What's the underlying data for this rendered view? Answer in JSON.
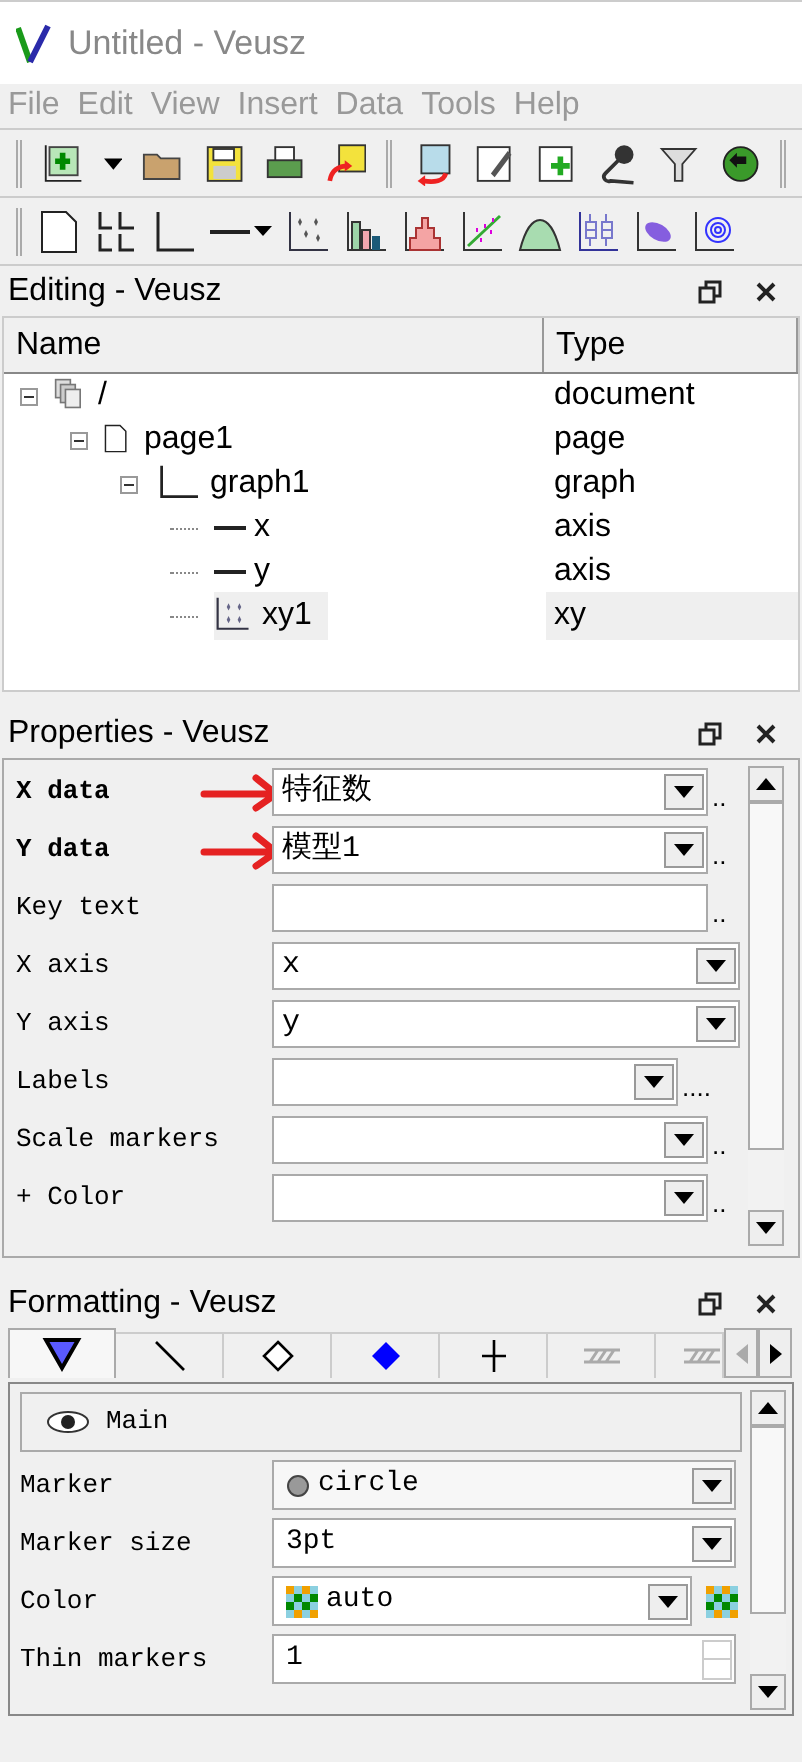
{
  "window": {
    "title": "Untitled - Veusz"
  },
  "menu": [
    "File",
    "Edit",
    "View",
    "Insert",
    "Data",
    "Tools",
    "Help"
  ],
  "editing": {
    "title": "Editing - Veusz",
    "columns": [
      "Name",
      "Type"
    ],
    "tree": [
      {
        "name": "/",
        "type": "document",
        "kind": "stack",
        "expanded": true,
        "selected": false,
        "children": [
          {
            "name": "page1",
            "type": "page",
            "kind": "sheet",
            "expanded": true,
            "selected": false,
            "children": [
              {
                "name": "graph1",
                "type": "graph",
                "kind": "frame",
                "expanded": true,
                "selected": false,
                "children": [
                  {
                    "name": "x",
                    "type": "axis",
                    "kind": "line",
                    "selected": false
                  },
                  {
                    "name": "y",
                    "type": "axis",
                    "kind": "line",
                    "selected": false
                  },
                  {
                    "name": "xy1",
                    "type": "xy",
                    "kind": "points",
                    "selected": true
                  }
                ]
              }
            ]
          }
        ]
      }
    ]
  },
  "properties": {
    "title": "Properties - Veusz",
    "rows": [
      {
        "label": "X data",
        "kind": "combo",
        "value": "特征数",
        "bold": true,
        "dots": "..",
        "annotated": true
      },
      {
        "label": "Y data",
        "kind": "combo",
        "value": "模型1",
        "bold": true,
        "dots": "..",
        "annotated": true
      },
      {
        "label": "Key text",
        "kind": "text",
        "bold": false,
        "dots": "..",
        "annotated": false
      },
      {
        "label": "X axis",
        "kind": "combo",
        "value": "x",
        "bold": false,
        "annotated": false
      },
      {
        "label": "Y axis",
        "kind": "combo",
        "value": "y",
        "bold": false,
        "annotated": false
      },
      {
        "label": "Labels",
        "kind": "combo",
        "bold": false,
        "dots": "....",
        "annotated": false
      },
      {
        "label": "Scale markers",
        "kind": "combo",
        "bold": false,
        "dots": "..",
        "annotated": false
      },
      {
        "label": "+ Color",
        "kind": "combo",
        "bold": false,
        "dots": "..",
        "annotated": false
      }
    ]
  },
  "formatting": {
    "title": "Formatting - Veusz",
    "tabs": [
      {
        "kind": "triangle",
        "selected": true
      },
      {
        "kind": "line",
        "selected": false
      },
      {
        "kind": "diamond",
        "selected": false
      },
      {
        "kind": "solid-diamond",
        "selected": false
      },
      {
        "kind": "cross",
        "selected": false
      },
      {
        "kind": "hatch",
        "selected": false
      },
      {
        "kind": "hatch",
        "selected": false
      }
    ],
    "section": "Main",
    "rows": [
      {
        "label": "Marker",
        "kind": "marker",
        "value": "circle"
      },
      {
        "label": "Marker size",
        "kind": "combo",
        "value": "3pt"
      },
      {
        "label": "Color",
        "kind": "color",
        "value": "auto"
      },
      {
        "label": "Thin markers",
        "kind": "spin",
        "value": "1"
      }
    ]
  }
}
